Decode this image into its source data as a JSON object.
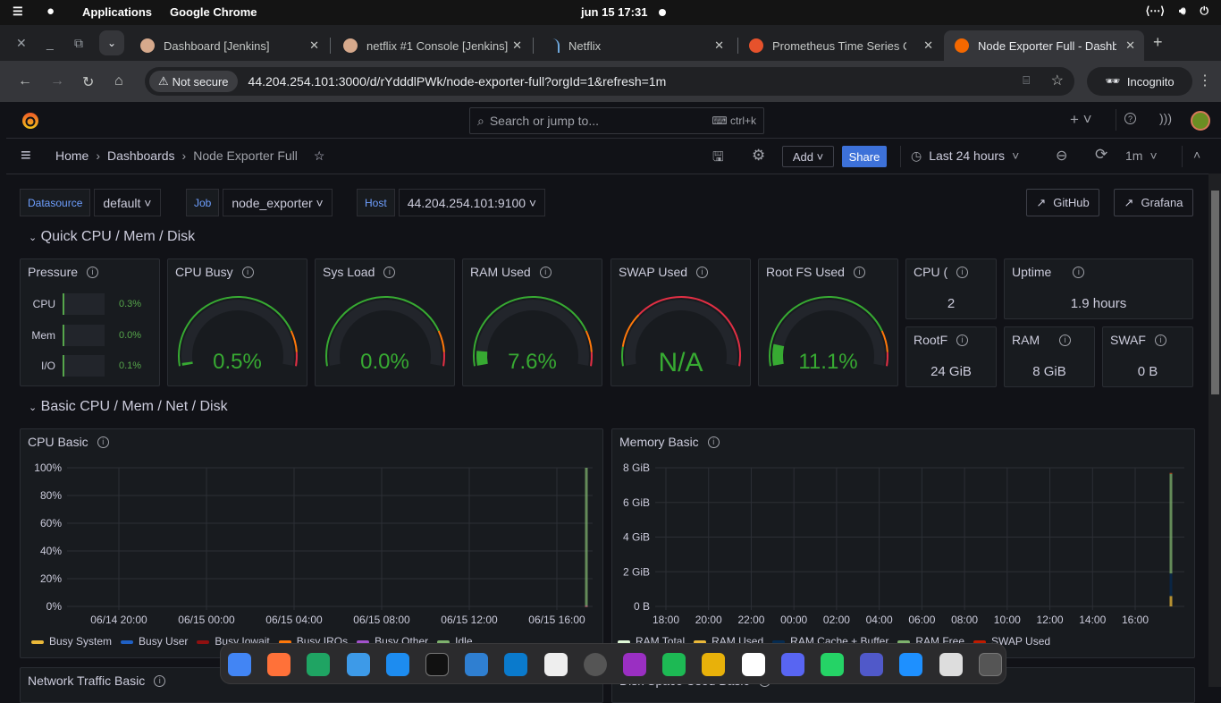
{
  "os_bar": {
    "menu_apps": "Applications",
    "menu_app": "Google Chrome",
    "clock": "jun 15  17:31"
  },
  "browser": {
    "tabs": [
      {
        "title": "Dashboard [Jenkins]",
        "favicon": "jenkins-icon",
        "active": false
      },
      {
        "title": "netflix #1 Console [Jenkins]",
        "favicon": "jenkins-icon",
        "active": false
      },
      {
        "title": "Netflix",
        "favicon": "netflix-icon",
        "active": false
      },
      {
        "title": "Prometheus Time Series Collection",
        "favicon": "prometheus-icon",
        "active": false
      },
      {
        "title": "Node Exporter Full - Dashboards",
        "favicon": "grafana-icon",
        "active": true
      }
    ],
    "security_label": "Not secure",
    "url": "44.204.254.101:3000/d/rYdddlPWk/node-exporter-full?orgId=1&refresh=1m",
    "incognito_label": "Incognito"
  },
  "grafana": {
    "search_placeholder": "Search or jump to...",
    "search_shortcut": "ctrl+k",
    "breadcrumb": [
      "Home",
      "Dashboards",
      "Node Exporter Full"
    ],
    "add_label": "Add",
    "share_label": "Share",
    "time_range": "Last 24 hours",
    "refresh_interval": "1m",
    "variables": [
      {
        "label": "Datasource",
        "value": "default"
      },
      {
        "label": "Job",
        "value": "node_exporter"
      },
      {
        "label": "Host",
        "value": "44.204.254.101:9100"
      }
    ],
    "links": [
      "GitHub",
      "Grafana"
    ],
    "rows": [
      {
        "title": "Quick CPU / Mem / Disk"
      },
      {
        "title": "Basic CPU / Mem / Net / Disk"
      }
    ],
    "pressure": {
      "title": "Pressure",
      "items": [
        {
          "label": "CPU",
          "value": "0.3%"
        },
        {
          "label": "Mem",
          "value": "0.0%"
        },
        {
          "label": "I/O",
          "value": "0.1%"
        }
      ]
    },
    "gauges": [
      {
        "title": "CPU Busy",
        "value": "0.5%",
        "percent": 0.5
      },
      {
        "title": "Sys Load",
        "value": "0.0%",
        "percent": 0.0
      },
      {
        "title": "RAM Used",
        "value": "7.6%",
        "percent": 7.6
      },
      {
        "title": "SWAP Used",
        "value": "N/A",
        "percent": null
      },
      {
        "title": "Root FS Used",
        "value": "11.1%",
        "percent": 11.1
      }
    ],
    "stats": [
      {
        "title": "CPU Cores",
        "display_title": "CPU (",
        "value": "2"
      },
      {
        "title": "Uptime",
        "display_title": "Uptime",
        "value": "1.9 hours"
      },
      {
        "title": "RootFS Total",
        "display_title": "RootF",
        "value": "24 GiB"
      },
      {
        "title": "RAM Total",
        "display_title": "RAM",
        "value": "8 GiB"
      },
      {
        "title": "SWAP Total",
        "display_title": "SWAF",
        "value": "0 B"
      }
    ],
    "bottom_panels": [
      "Network Traffic Basic",
      "Disk Space Used Basic"
    ]
  },
  "chart_data": [
    {
      "type": "area",
      "title": "CPU Basic",
      "ylabel": "",
      "xlabel": "",
      "ylim": [
        0,
        100
      ],
      "yticks": [
        "0%",
        "20%",
        "40%",
        "60%",
        "80%",
        "100%"
      ],
      "xticks": [
        "06/14 20:00",
        "06/15 00:00",
        "06/15 04:00",
        "06/15 08:00",
        "06/15 12:00",
        "06/15 16:00"
      ],
      "grid": true,
      "legend_position": "bottom",
      "series": [
        {
          "name": "Busy System",
          "color": "#eab839",
          "values": [
            0.2
          ]
        },
        {
          "name": "Busy User",
          "color": "#1f60c4",
          "values": [
            0.3
          ]
        },
        {
          "name": "Busy Iowait",
          "color": "#8f1010",
          "values": [
            0.0
          ]
        },
        {
          "name": "Busy IRQs",
          "color": "#ff780a",
          "values": [
            0.0
          ]
        },
        {
          "name": "Busy Other",
          "color": "#a352cc",
          "values": [
            0.0
          ]
        },
        {
          "name": "Idle",
          "color": "#7eb26d",
          "values": [
            99.5
          ]
        }
      ],
      "x": [
        "06/15 17:30"
      ]
    },
    {
      "type": "area",
      "title": "Memory Basic",
      "ylabel": "",
      "xlabel": "",
      "ylim": [
        0,
        8
      ],
      "yticks": [
        "0 B",
        "2 GiB",
        "4 GiB",
        "6 GiB",
        "8 GiB"
      ],
      "xticks": [
        "18:00",
        "20:00",
        "22:00",
        "00:00",
        "02:00",
        "04:00",
        "06:00",
        "08:00",
        "10:00",
        "12:00",
        "14:00",
        "16:00"
      ],
      "grid": true,
      "legend_position": "bottom",
      "series": [
        {
          "name": "RAM Total",
          "color": "#e0f9d7",
          "values": [
            7.7
          ]
        },
        {
          "name": "RAM Used",
          "color": "#eab839",
          "values": [
            0.6
          ]
        },
        {
          "name": "RAM Cache + Buffer",
          "color": "#052b51",
          "values": [
            1.3
          ]
        },
        {
          "name": "RAM Free",
          "color": "#7eb26d",
          "values": [
            5.8
          ]
        },
        {
          "name": "SWAP Used",
          "color": "#bf1b00",
          "values": [
            0
          ]
        }
      ],
      "x": [
        "17:30"
      ]
    }
  ],
  "dock": {
    "apps": [
      "Chrome",
      "Firefox",
      "Google Drive",
      "Finder",
      "App Store",
      "Terminal",
      "Screenshot",
      "VS Code",
      "TextEdit",
      "Settings",
      "Flame",
      "Spotify",
      "Network",
      "Slack",
      "Discord",
      "WhatsApp",
      "Teams",
      "Remote Desktop",
      "Trash",
      "App Grid"
    ]
  }
}
